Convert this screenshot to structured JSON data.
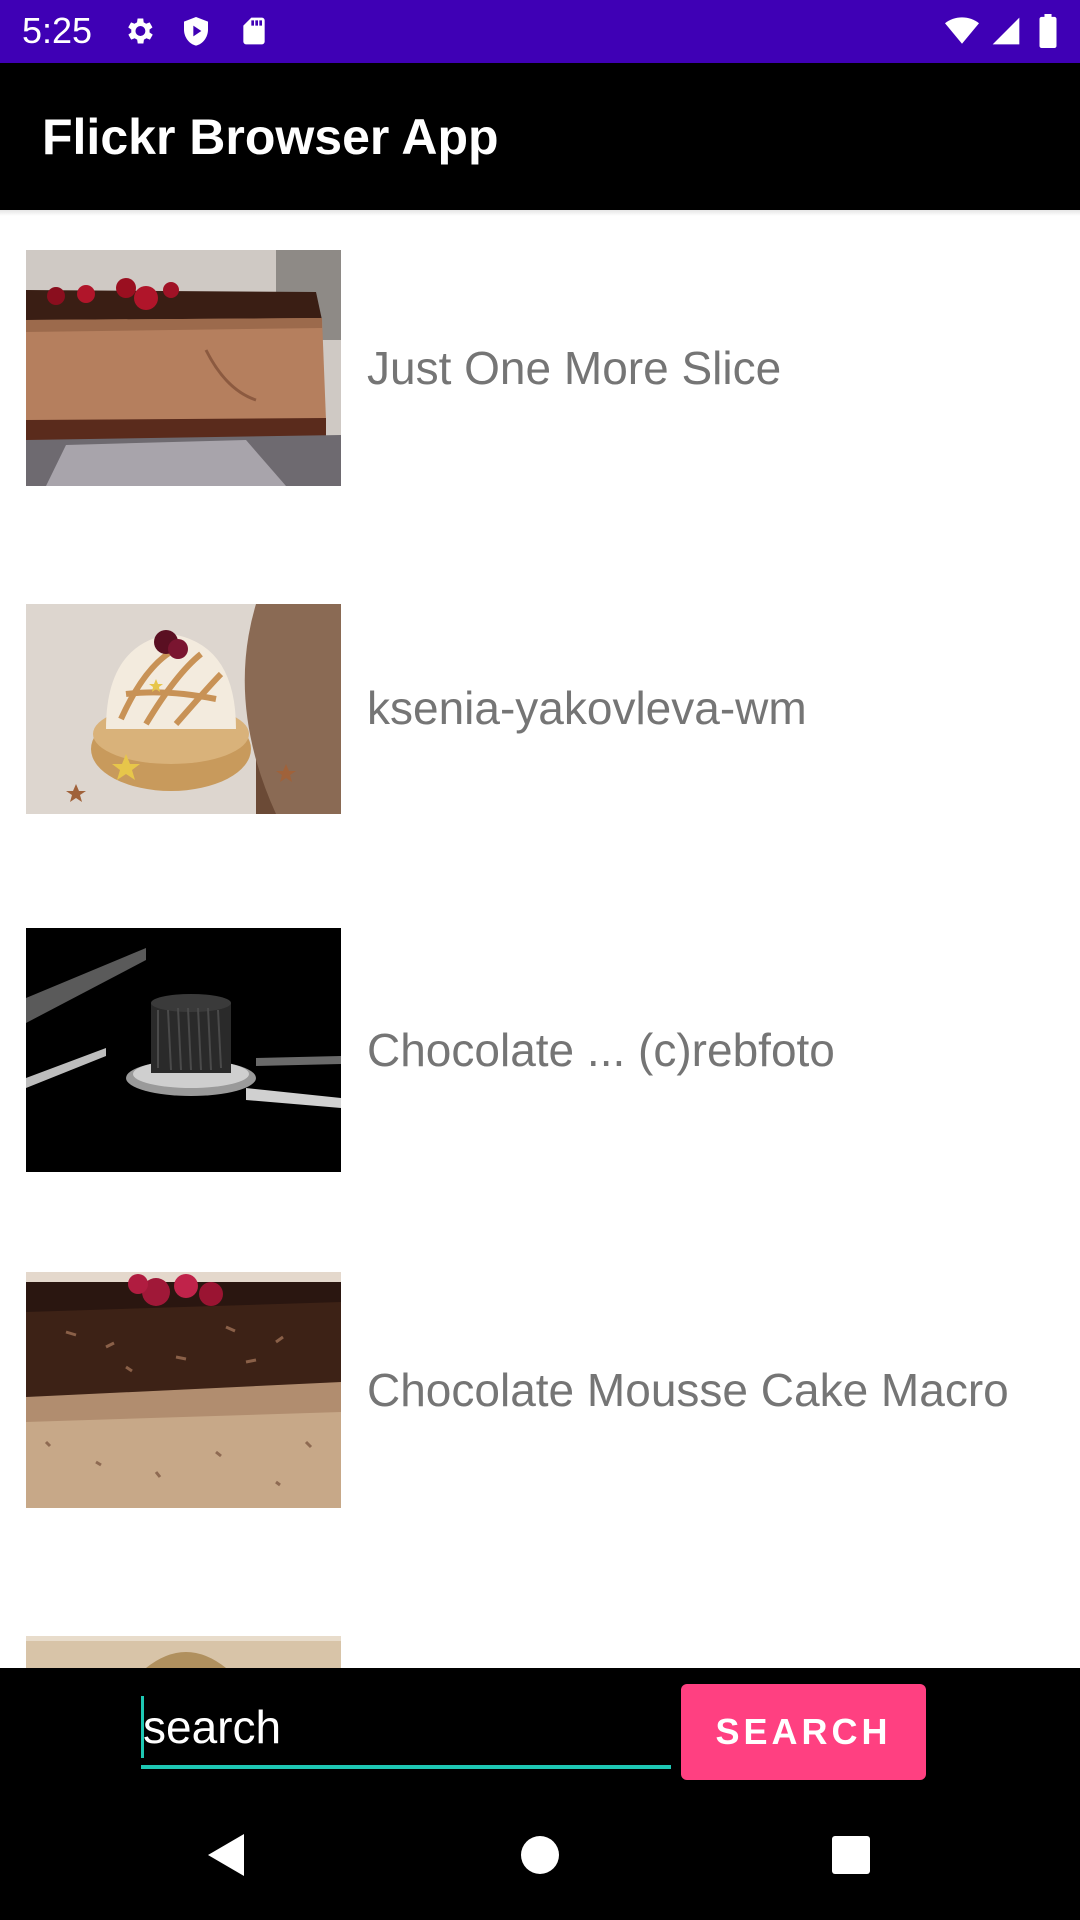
{
  "status_bar": {
    "time": "5:25",
    "background": "#3f00b5",
    "icons": [
      "settings-gear-icon",
      "play-protect-icon",
      "sd-card-icon",
      "wifi-icon",
      "cell-signal-icon",
      "battery-icon"
    ]
  },
  "app_bar": {
    "title": "Flickr Browser App",
    "background": "#000000"
  },
  "photos": [
    {
      "title": "Just One More Slice",
      "thumbnail": "chocolate-mousse-cake-slice"
    },
    {
      "title": "ksenia-yakovleva-wm",
      "thumbnail": "meringue-tart"
    },
    {
      "title": "Chocolate ... (c)rebfoto",
      "thumbnail": "black-chocolate-cake-on-stand"
    },
    {
      "title": "Chocolate Mousse Cake Macro",
      "thumbnail": "chocolate-mousse-cake-macro"
    },
    {
      "title": "",
      "thumbnail": "partially-visible-cake"
    }
  ],
  "search": {
    "placeholder": "search",
    "value": "",
    "button_label": "SEARCH",
    "accent": "#1ec8b4",
    "button_color": "#ff4081"
  },
  "nav_bar": {
    "icons": [
      "back-icon",
      "home-icon",
      "recents-icon"
    ]
  }
}
